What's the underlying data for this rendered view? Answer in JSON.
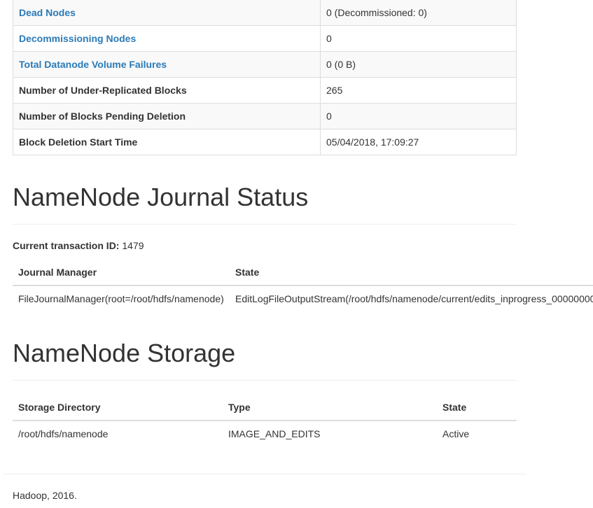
{
  "summary_rows": [
    {
      "label": "Dead Nodes",
      "value": "0 (Decommissioned: 0)",
      "link": true
    },
    {
      "label": "Decommissioning Nodes",
      "value": "0",
      "link": true
    },
    {
      "label": "Total Datanode Volume Failures",
      "value": "0 (0 B)",
      "link": true
    },
    {
      "label": "Number of Under-Replicated Blocks",
      "value": "265",
      "link": false
    },
    {
      "label": "Number of Blocks Pending Deletion",
      "value": "0",
      "link": false
    },
    {
      "label": "Block Deletion Start Time",
      "value": "05/04/2018, 17:09:27",
      "link": false
    }
  ],
  "journal": {
    "heading": "NameNode Journal Status",
    "txid_label": "Current transaction ID:",
    "txid_value": "1479",
    "columns": [
      "Journal Manager",
      "State"
    ],
    "rows": [
      [
        "FileJournalManager(root=/root/hdfs/namenode)",
        "EditLogFileOutputStream(/root/hdfs/namenode/current/edits_inprogress_00000000"
      ]
    ]
  },
  "storage": {
    "heading": "NameNode Storage",
    "columns": [
      "Storage Directory",
      "Type",
      "State"
    ],
    "rows": [
      [
        "/root/hdfs/namenode",
        "IMAGE_AND_EDITS",
        "Active"
      ]
    ]
  },
  "footer": "Hadoop, 2016.",
  "colors": {
    "link": "#2a7ab8",
    "text": "#333333",
    "stripe": "#f9f9f9",
    "border": "#dddddd"
  }
}
